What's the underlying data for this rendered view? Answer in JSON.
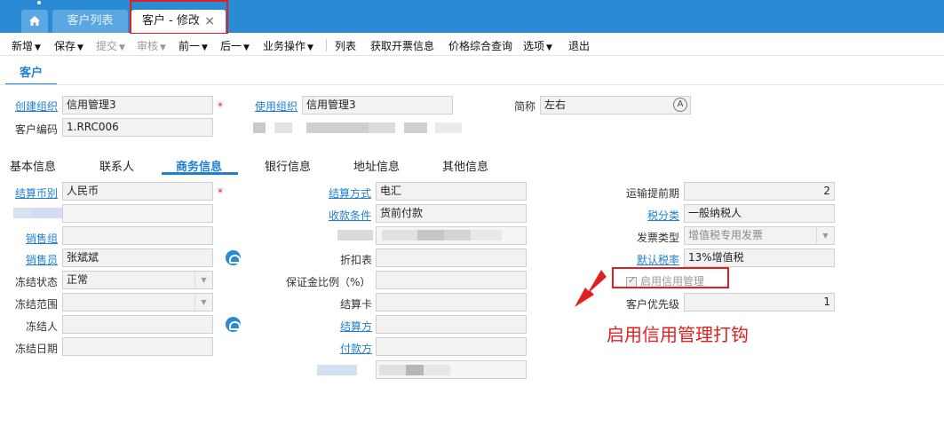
{
  "tabs": {
    "home_icon": "home-icon",
    "list": "客户列表",
    "active": "客户 - 修改",
    "close": "×"
  },
  "toolbar": {
    "new": "新增",
    "save": "保存",
    "submit": "提交",
    "audit": "审核",
    "prev": "前一",
    "next": "后一",
    "biz": "业务操作",
    "list": "列表",
    "invoice": "获取开票信息",
    "price": "价格综合查询",
    "options": "选项",
    "exit": "退出"
  },
  "section": {
    "title": "客户"
  },
  "header": {
    "create_org_label": "创建组织",
    "create_org_value": "信用管理3",
    "use_org_label": "使用组织",
    "use_org_value": "信用管理3",
    "short_name_label": "简称",
    "short_name_value": "左右",
    "code_label": "客户编码",
    "code_value": "1.RRC006"
  },
  "subtabs": [
    "基本信息",
    "联系人",
    "商务信息",
    "银行信息",
    "地址信息",
    "其他信息"
  ],
  "col1": {
    "currency_label": "结算币别",
    "currency_value": "人民币",
    "sales_group_label": "销售组",
    "salesman_label": "销售员",
    "salesman_value": "张斌斌",
    "freeze_status_label": "冻结状态",
    "freeze_status_value": "正常",
    "freeze_scope_label": "冻结范围",
    "freezer_label": "冻结人",
    "freeze_date_label": "冻结日期"
  },
  "col2": {
    "settle_method_label": "结算方式",
    "settle_method_value": "电汇",
    "payment_terms_label": "收款条件",
    "payment_terms_value": "货前付款",
    "discount_label": "折扣表",
    "deposit_label": "保证金比例（%）",
    "settle_card_label": "结算卡",
    "settle_party_label": "结算方",
    "payer_label": "付款方"
  },
  "col3": {
    "transport_label": "运输提前期",
    "transport_value": "2",
    "tax_class_label": "税分类",
    "tax_class_value": "一般纳税人",
    "invoice_type_label": "发票类型",
    "invoice_type_value": "增值税专用发票",
    "default_tax_label": "默认税率",
    "default_tax_value": "13%增值税",
    "credit_mgmt_label": "启用信用管理",
    "credit_mgmt_checked": true,
    "priority_label": "客户优先级",
    "priority_value": "1"
  },
  "annotation": {
    "text": "启用信用管理打钩"
  },
  "colors": {
    "accent": "#1f7fd1",
    "tabbar": "#2a8ad4",
    "highlight": "#e02020"
  }
}
